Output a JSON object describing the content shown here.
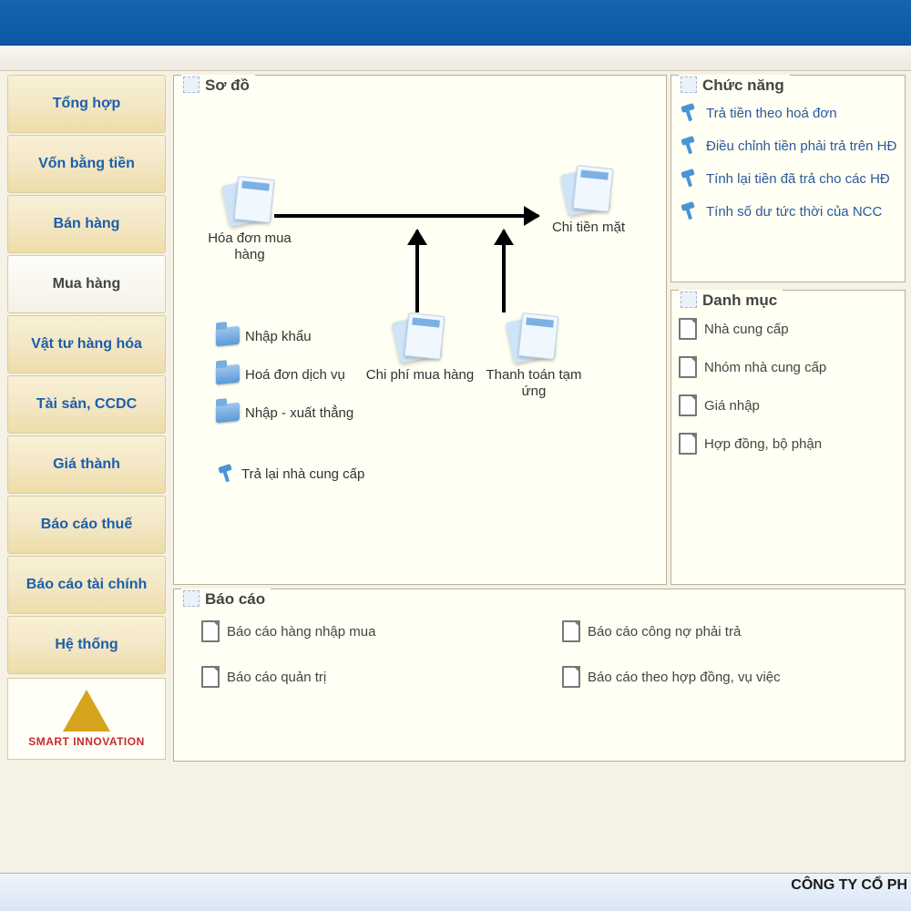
{
  "sidebar": {
    "items": [
      {
        "label": "Tổng hợp"
      },
      {
        "label": "Vốn bằng tiền"
      },
      {
        "label": "Bán hàng"
      },
      {
        "label": "Mua hàng"
      },
      {
        "label": "Vật tư hàng hóa"
      },
      {
        "label": "Tài sản, CCDC"
      },
      {
        "label": "Giá thành"
      },
      {
        "label": "Báo cáo thuế"
      },
      {
        "label": "Báo cáo tài chính"
      },
      {
        "label": "Hệ thống"
      }
    ],
    "selected_index": 3,
    "logo_text": "SMART INNOVATION"
  },
  "diagram": {
    "title": "Sơ đồ",
    "nodes": {
      "invoice": "Hóa đơn mua hàng",
      "cash": "Chi tiền mặt",
      "cost": "Chi phí mua hàng",
      "advance": "Thanh toán  tạm ứng"
    },
    "links": {
      "import": "Nhập khẩu",
      "service_invoice": "Hoá đơn dịch vụ",
      "direct_io": "Nhập - xuất thẳng",
      "return_supplier": "Trả lại nhà cung cấp"
    }
  },
  "functions": {
    "title": "Chức năng",
    "items": [
      {
        "label": "Trả tiền theo hoá đơn"
      },
      {
        "label": "Điều chỉnh tiền phải trả trên HĐ"
      },
      {
        "label": "Tính lại tiền đã trả cho các HĐ"
      },
      {
        "label": "Tính số dư tức thời của NCC"
      }
    ]
  },
  "catalog": {
    "title": "Danh mục",
    "items": [
      {
        "label": "Nhà cung cấp"
      },
      {
        "label": "Nhóm nhà cung cấp"
      },
      {
        "label": "Giá nhập"
      },
      {
        "label": "Hợp đồng, bộ phận"
      }
    ]
  },
  "reports": {
    "title": "Báo cáo",
    "left": [
      {
        "label": "Báo cáo hàng nhập mua"
      },
      {
        "label": "Báo cáo quản trị"
      }
    ],
    "right": [
      {
        "label": "Báo cáo công nợ phải trả"
      },
      {
        "label": "Báo cáo theo hợp đồng, vụ việc"
      }
    ]
  },
  "footer": {
    "company": "CÔNG TY CỔ PH"
  }
}
